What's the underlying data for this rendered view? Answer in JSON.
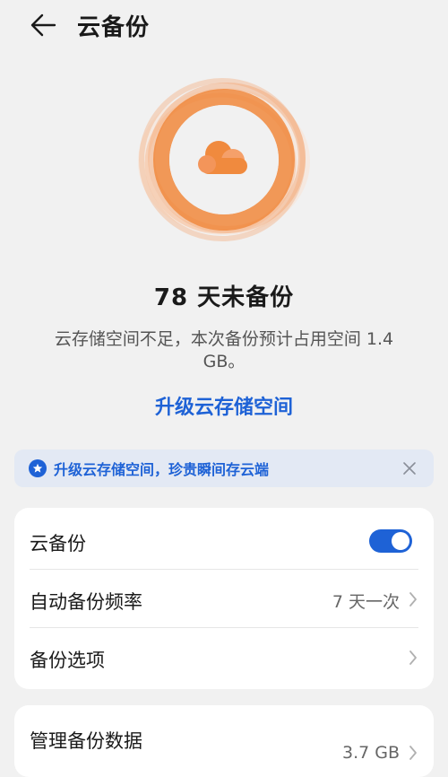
{
  "header": {
    "title": "云备份",
    "back_icon": "arrow-left-icon"
  },
  "hero": {
    "icon": "cloud-icon",
    "accent_color": "#f08a3e"
  },
  "status": {
    "title": "78 天未备份",
    "description": "云存储空间不足，本次备份预计占用空间 1.4 GB。"
  },
  "upgrade_link": "升级云存储空间",
  "banner": {
    "icon": "star-badge-icon",
    "text": "升级云存储空间，珍贵瞬间存云端",
    "close_icon": "close-icon"
  },
  "settings": {
    "cloud_backup": {
      "label": "云备份",
      "toggle_on": true
    },
    "frequency": {
      "label": "自动备份频率",
      "value": "7 天一次"
    },
    "options": {
      "label": "备份选项"
    }
  },
  "manage": {
    "label": "管理备份数据",
    "value": "3.7 GB"
  },
  "colors": {
    "accent_blue": "#1e62d6",
    "orange": "#f08a3e",
    "background": "#f1f1f1"
  }
}
